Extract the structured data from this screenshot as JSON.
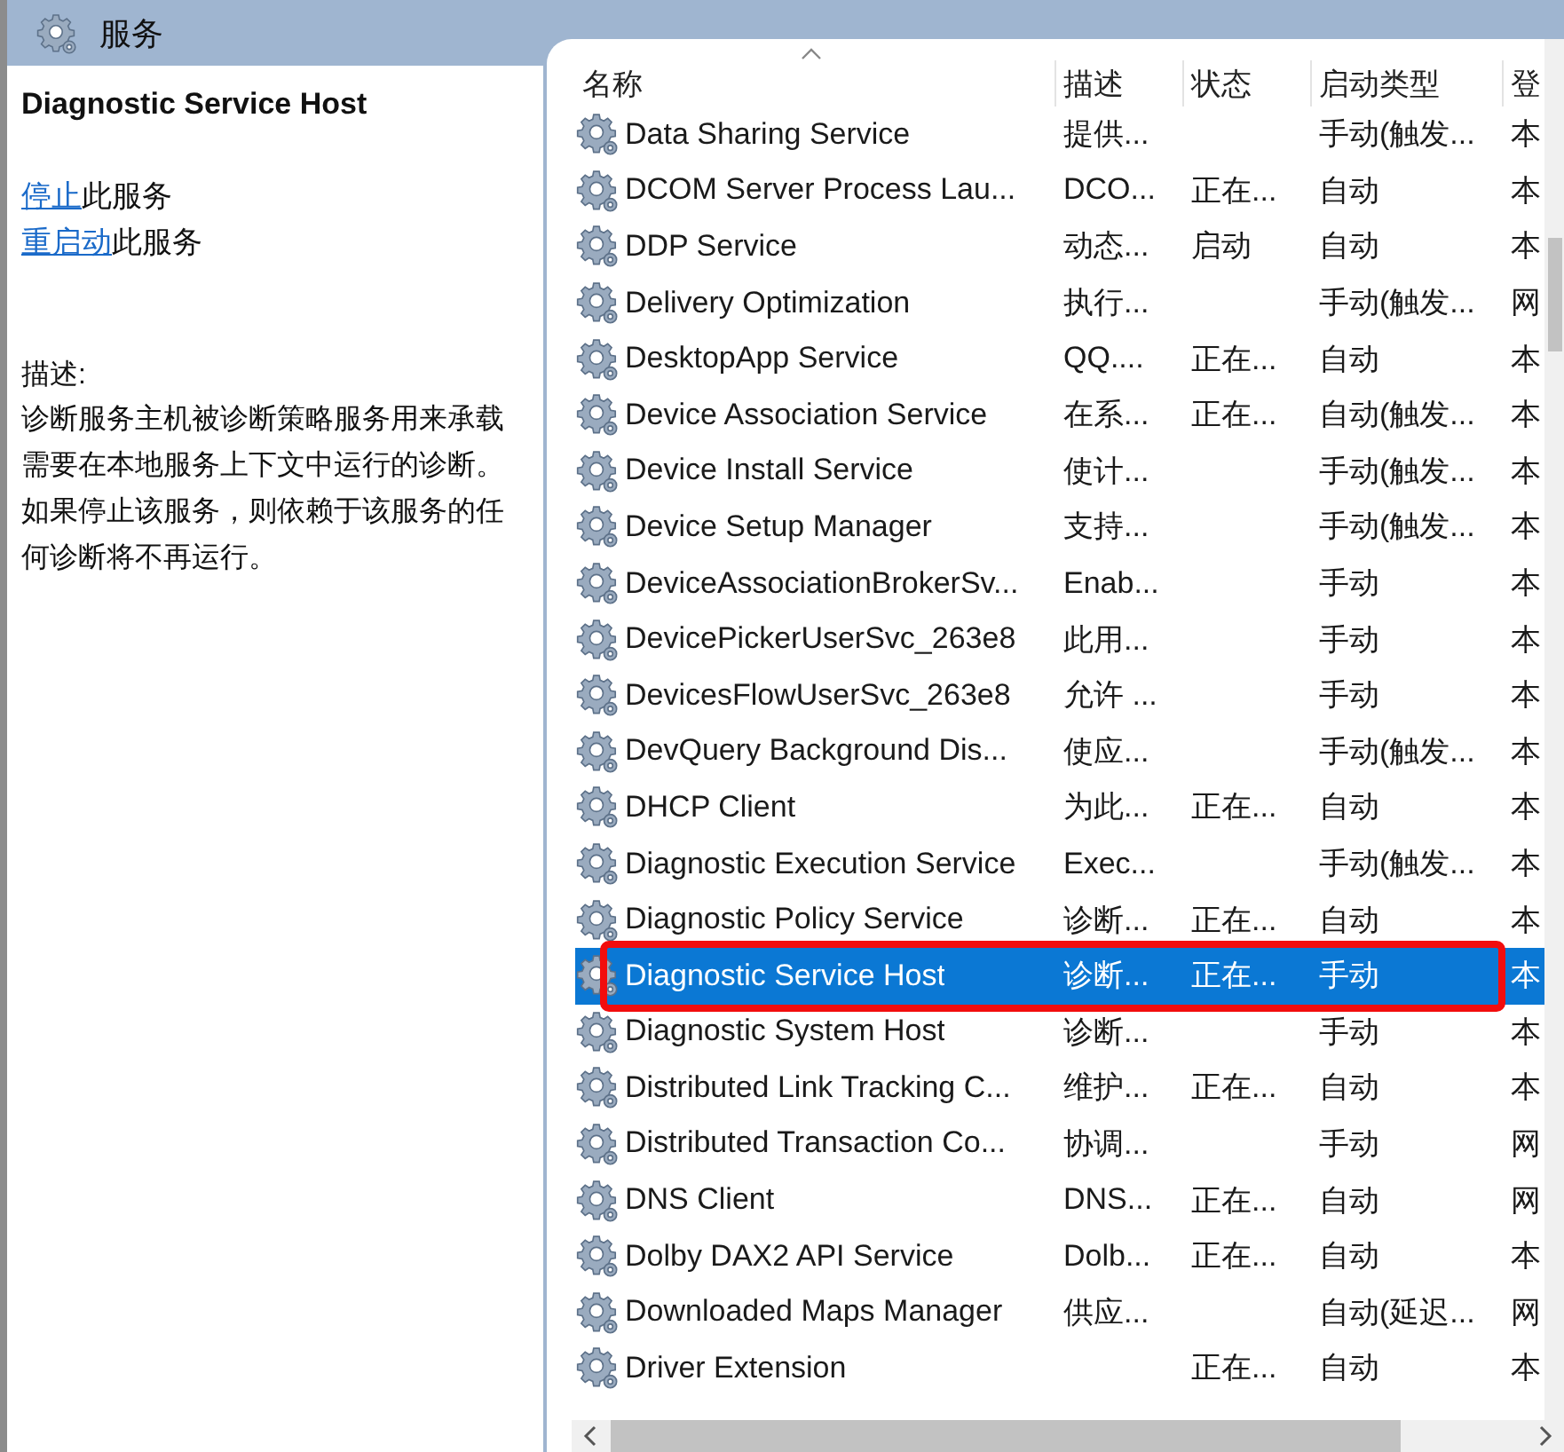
{
  "window": {
    "title": "服务"
  },
  "details": {
    "service_name": "Diagnostic Service Host",
    "actions": [
      {
        "link": "停止",
        "text": "此服务"
      },
      {
        "link": "重启动",
        "text": "此服务"
      }
    ],
    "description_label": "描述:",
    "description": "诊断服务主机被诊断策略服务用来承载需要在本地服务上下文中运行的诊断。如果停止该服务，则依赖于该服务的任何诊断将不再运行。"
  },
  "table": {
    "columns": [
      "名称",
      "描述",
      "状态",
      "启动类型",
      "登"
    ],
    "rows": [
      {
        "name": "Data Sharing Service",
        "description": "提供...",
        "startup_type": "手动(触发...",
        "column_5": "本",
        "selected": false
      },
      {
        "name": "DCOM Server Process Lau...",
        "description": "DCO...",
        "status": "正在...",
        "startup_type": "自动",
        "column_5": "本",
        "selected": false
      },
      {
        "name": "DDP Service",
        "description": "动态...",
        "status": "启动",
        "startup_type": "自动",
        "column_5": "本",
        "selected": false
      },
      {
        "name": "Delivery Optimization",
        "description": "执行...",
        "startup_type": "手动(触发...",
        "column_5": "网",
        "selected": false
      },
      {
        "name": "DesktopApp Service",
        "description": "QQ....",
        "status": "正在...",
        "startup_type": "自动",
        "column_5": "本",
        "selected": false
      },
      {
        "name": "Device Association Service",
        "description": "在系...",
        "status": "正在...",
        "startup_type": "自动(触发...",
        "column_5": "本",
        "selected": false
      },
      {
        "name": "Device Install Service",
        "description": "使计...",
        "startup_type": "手动(触发...",
        "column_5": "本",
        "selected": false
      },
      {
        "name": "Device Setup Manager",
        "description": "支持...",
        "startup_type": "手动(触发...",
        "column_5": "本",
        "selected": false
      },
      {
        "name": "DeviceAssociationBrokerSv...",
        "description": "Enab...",
        "startup_type": "手动",
        "column_5": "本",
        "selected": false
      },
      {
        "name": "DevicePickerUserSvc_263e8",
        "description": "此用...",
        "startup_type": "手动",
        "column_5": "本",
        "selected": false
      },
      {
        "name": "DevicesFlowUserSvc_263e8",
        "description": "允许 ...",
        "startup_type": "手动",
        "column_5": "本",
        "selected": false
      },
      {
        "name": "DevQuery Background Dis...",
        "description": "使应...",
        "startup_type": "手动(触发...",
        "column_5": "本",
        "selected": false
      },
      {
        "name": "DHCP Client",
        "description": "为此...",
        "status": "正在...",
        "startup_type": "自动",
        "column_5": "本",
        "selected": false
      },
      {
        "name": "Diagnostic Execution Service",
        "description": "Exec...",
        "startup_type": "手动(触发...",
        "column_5": "本",
        "selected": false
      },
      {
        "name": "Diagnostic Policy Service",
        "description": "诊断...",
        "status": "正在...",
        "startup_type": "自动",
        "column_5": "本",
        "selected": false
      },
      {
        "name": "Diagnostic Service Host",
        "description": "诊断...",
        "status": "正在...",
        "startup_type": "手动",
        "column_5": "本",
        "selected": true
      },
      {
        "name": "Diagnostic System Host",
        "description": "诊断...",
        "startup_type": "手动",
        "column_5": "本",
        "selected": false
      },
      {
        "name": "Distributed Link Tracking C...",
        "description": "维护...",
        "status": "正在...",
        "startup_type": "自动",
        "column_5": "本",
        "selected": false
      },
      {
        "name": "Distributed Transaction Co...",
        "description": "协调...",
        "startup_type": "手动",
        "column_5": "网",
        "selected": false
      },
      {
        "name": "DNS Client",
        "description": "DNS...",
        "status": "正在...",
        "startup_type": "自动",
        "column_5": "网",
        "selected": false
      },
      {
        "name": "Dolby DAX2 API Service",
        "description": "Dolb...",
        "status": "正在...",
        "startup_type": "自动",
        "column_5": "本",
        "selected": false
      },
      {
        "name": "Downloaded Maps Manager",
        "description": "供应...",
        "startup_type": "自动(延迟...",
        "column_5": "网",
        "selected": false
      },
      {
        "name": "Driver Extension",
        "status": "正在...",
        "startup_type": "自动",
        "column_5": "本",
        "selected": false
      }
    ]
  }
}
